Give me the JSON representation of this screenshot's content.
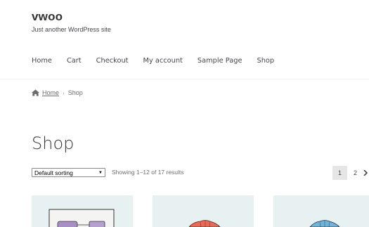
{
  "site": {
    "title": "vwoo",
    "tagline": "Just another WordPress site"
  },
  "nav": {
    "items": [
      {
        "label": "Home"
      },
      {
        "label": "Cart"
      },
      {
        "label": "Checkout"
      },
      {
        "label": "My account"
      },
      {
        "label": "Sample Page"
      },
      {
        "label": "Shop"
      }
    ]
  },
  "breadcrumb": {
    "home_label": "Home",
    "separator": "›",
    "current": "Shop"
  },
  "page": {
    "title": "Shop"
  },
  "toolbar": {
    "sorting_selected": "Default sorting",
    "result_count": "Showing 1–12 of 17 results"
  },
  "pagination": {
    "pages": [
      "1",
      "2"
    ],
    "current": "1"
  },
  "products": [
    {
      "icon": "poster-image"
    },
    {
      "icon": "hoodie-red-image"
    },
    {
      "icon": "hoodie-blue-image"
    }
  ]
}
